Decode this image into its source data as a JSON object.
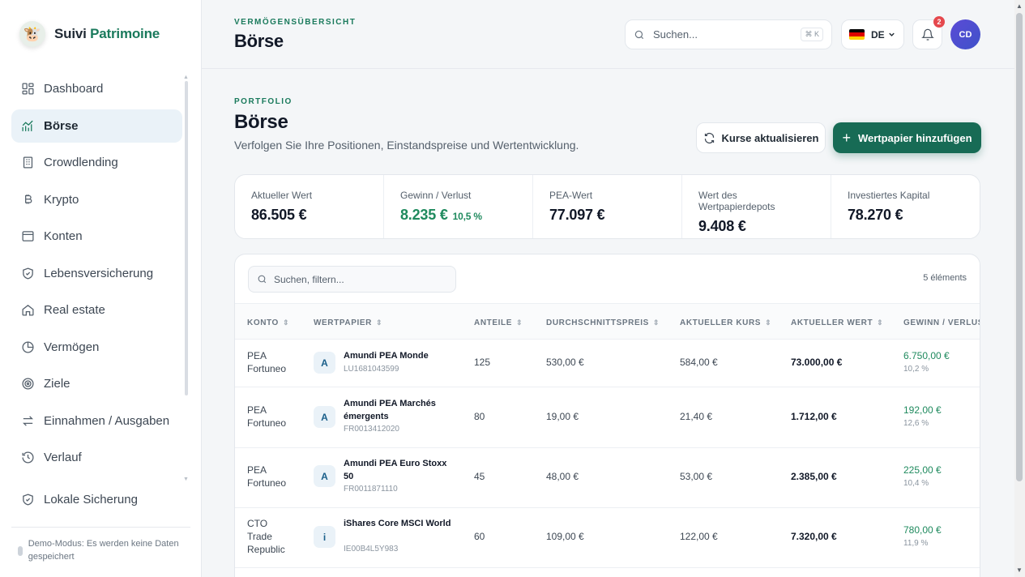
{
  "brand": {
    "name_part1": "Suivi",
    "name_part2": "Patrimoine",
    "logo_icon": "cow-mascot-icon"
  },
  "sidebar": {
    "items": [
      {
        "label": "Dashboard",
        "icon": "dashboard-icon",
        "active": false
      },
      {
        "label": "Börse",
        "icon": "chart-line-icon",
        "active": true
      },
      {
        "label": "Crowdlending",
        "icon": "building-icon",
        "active": false
      },
      {
        "label": "Krypto",
        "icon": "bitcoin-icon",
        "active": false
      },
      {
        "label": "Konten",
        "icon": "wallet-icon",
        "active": false
      },
      {
        "label": "Lebensversicherung",
        "icon": "shield-icon",
        "active": false
      },
      {
        "label": "Real estate",
        "icon": "home-icon",
        "active": false
      },
      {
        "label": "Vermögen",
        "icon": "pie-chart-icon",
        "active": false
      },
      {
        "label": "Ziele",
        "icon": "target-icon",
        "active": false
      },
      {
        "label": "Einnahmen / Ausgaben",
        "icon": "arrows-icon",
        "active": false
      },
      {
        "label": "Verlauf",
        "icon": "history-icon",
        "active": false
      }
    ],
    "secondary": {
      "label": "Lokale Sicherung",
      "icon": "shield-check-icon"
    },
    "demo_notice": "Demo-Modus: Es werden keine Daten gespeichert"
  },
  "topbar": {
    "kicker": "VERMÖGENSÜBERSICHT",
    "title": "Börse",
    "search_placeholder": "Suchen...",
    "search_shortcut": "⌘ K",
    "language": "DE",
    "notification_count": "2",
    "avatar_initials": "CD"
  },
  "page": {
    "kicker": "PORTFOLIO",
    "title": "Börse",
    "subtitle": "Verfolgen Sie Ihre Positionen, Einstandspreise und Wertentwicklung.",
    "refresh_button": "Kurse aktualisieren",
    "add_button": "Wertpapier hinzufügen"
  },
  "stats": [
    {
      "label": "Aktueller Wert",
      "value": "86.505 €"
    },
    {
      "label": "Gewinn / Verlust",
      "value": "8.235 €",
      "pct": "10,5 %"
    },
    {
      "label": "PEA-Wert",
      "value": "77.097 €"
    },
    {
      "label": "Wert des Wertpapierdepots",
      "value": "9.408 €"
    },
    {
      "label": "Investiertes Kapital",
      "value": "78.270 €"
    }
  ],
  "table": {
    "filter_placeholder": "Suchen, filtern...",
    "count": "5 éléments",
    "headers": [
      "KONTO",
      "WERTPAPIER",
      "ANTEILE",
      "DURCHSCHNITTSPREIS",
      "AKTUELLER KURS",
      "AKTUELLER WERT",
      "GEWINN / VERLUST"
    ],
    "rows": [
      {
        "konto1": "PEA",
        "konto2": "Fortuneo",
        "konto3": "",
        "initial": "A",
        "name": "Amundi PEA Monde",
        "isin": "LU1681043599",
        "anteile": "125",
        "avg": "530,00 €",
        "kurs": "584,00 €",
        "wert": "73.000,00 €",
        "gain": "6.750,00 €",
        "gain_pct": "10,2 %"
      },
      {
        "konto1": "PEA",
        "konto2": "Fortuneo",
        "konto3": "",
        "initial": "A",
        "name": "Amundi PEA Marchés émergents",
        "isin": "FR0013412020",
        "anteile": "80",
        "avg": "19,00 €",
        "kurs": "21,40 €",
        "wert": "1.712,00 €",
        "gain": "192,00 €",
        "gain_pct": "12,6 %"
      },
      {
        "konto1": "PEA",
        "konto2": "Fortuneo",
        "konto3": "",
        "initial": "A",
        "name": "Amundi PEA Euro Stoxx 50",
        "isin": "FR0011871110",
        "anteile": "45",
        "avg": "48,00 €",
        "kurs": "53,00 €",
        "wert": "2.385,00 €",
        "gain": "225,00 €",
        "gain_pct": "10,4 %"
      },
      {
        "konto1": "CTO",
        "konto2": "Trade",
        "konto3": "Republic",
        "initial": "i",
        "name": "iShares Core MSCI World",
        "isin": "IE00B4L5Y983",
        "anteile": "60",
        "avg": "109,00 €",
        "kurs": "122,00 €",
        "wert": "7.320,00 €",
        "gain": "780,00 €",
        "gain_pct": "11,9 %"
      }
    ]
  }
}
